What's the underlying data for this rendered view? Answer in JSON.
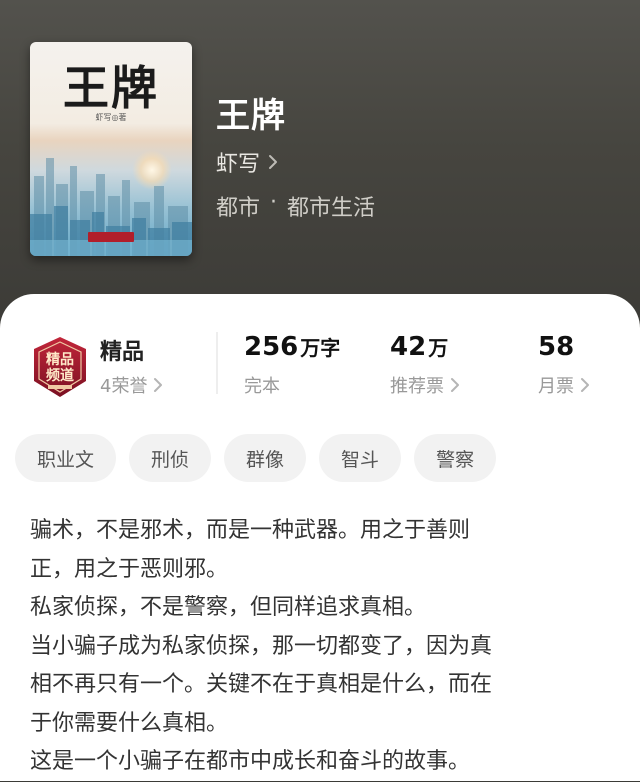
{
  "book": {
    "cover_title": "王牌",
    "cover_author": "虾写◎著",
    "title": "王牌",
    "author": "虾写",
    "genre": "都市",
    "genre_separator": "·",
    "subgenre": "都市生活"
  },
  "honor": {
    "badge_text": "精品频道",
    "label": "精品",
    "count_text": "4荣誉"
  },
  "stats": [
    {
      "value": "256",
      "unit": "万字",
      "label": "完本"
    },
    {
      "value": "42",
      "unit": "万",
      "label": "推荐票"
    },
    {
      "value": "58",
      "unit": "",
      "label": "月票"
    }
  ],
  "tags": [
    "职业文",
    "刑侦",
    "群像",
    "智斗",
    "警察"
  ],
  "description": [
    "骗术，不是邪术，而是一种武器。用之于善则",
    "正，用之于恶则邪。",
    "私家侦探，不是警察，但同样追求真相。",
    "当小骗子成为私家侦探，那一切都变了，因为真",
    "相不再只有一个。关键不在于真相是什么，而在",
    "于你需要什么真相。",
    "这是一个小骗子在都市中成长和奋斗的故事。"
  ],
  "colors": {
    "header_bg": "#46453f",
    "badge_red": "#b11e2a",
    "tag_bg": "#f2f2f2"
  }
}
